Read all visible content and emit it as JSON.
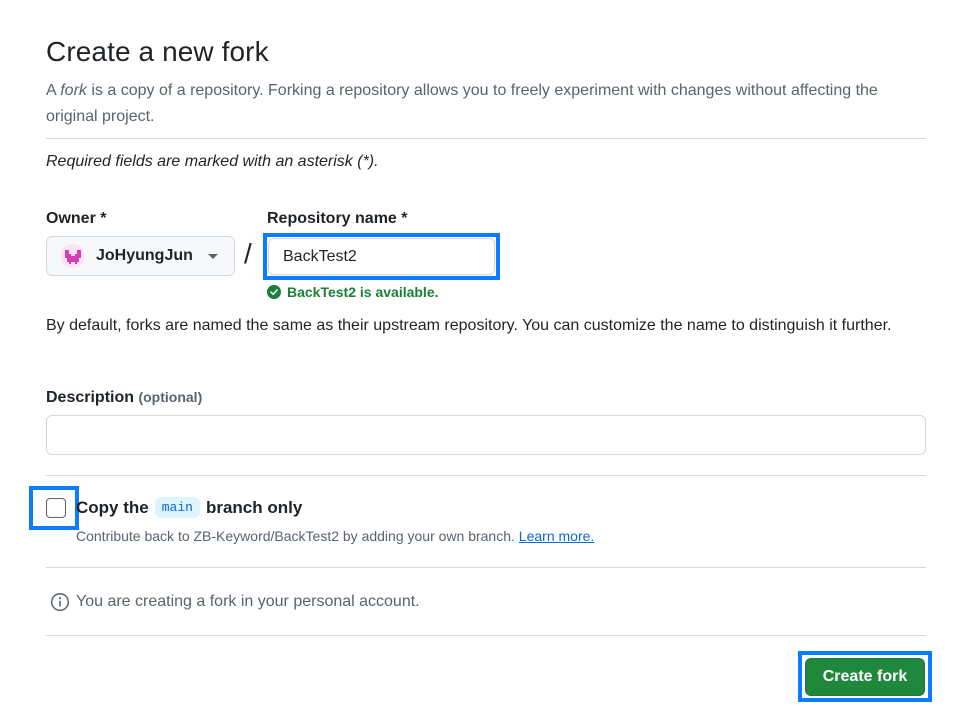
{
  "header": {
    "title": "Create a new fork",
    "subtitle_prefix": "A ",
    "subtitle_em": "fork",
    "subtitle_rest": " is a copy of a repository. Forking a repository allows you to freely experiment with changes without affecting the original project."
  },
  "required_note": "Required fields are marked with an asterisk (*).",
  "owner": {
    "label": "Owner *",
    "value": "JoHyungJun"
  },
  "separator": "/",
  "repository": {
    "label": "Repository name *",
    "value": "BackTest2",
    "availability": "BackTest2 is available."
  },
  "naming_help": "By default, forks are named the same as their upstream repository. You can customize the name to distinguish it further.",
  "description": {
    "label": "Description",
    "optional": "(optional)",
    "value": ""
  },
  "copy_branch": {
    "label_prefix": "Copy the",
    "branch": "main",
    "label_suffix": "branch only",
    "checked": false,
    "help": "Contribute back to ZB-Keyword/BackTest2 by adding your own branch.",
    "learn_more": "Learn more."
  },
  "info": {
    "icon": "info-icon",
    "text": "You are creating a fork in your personal account."
  },
  "actions": {
    "create_label": "Create fork"
  },
  "colors": {
    "accent_focus": "#0a7cff",
    "primary_button": "#1f883d",
    "success": "#1a7f37",
    "link": "#0969da"
  }
}
